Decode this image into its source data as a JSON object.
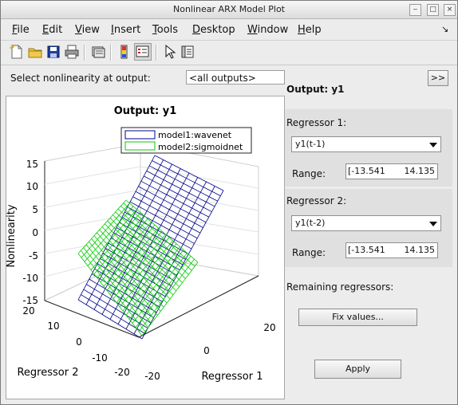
{
  "window": {
    "title": "Nonlinear ARX Model Plot"
  },
  "menu": {
    "items": [
      {
        "label": "File",
        "u": "F"
      },
      {
        "label": "Edit",
        "u": "E"
      },
      {
        "label": "View",
        "u": "V"
      },
      {
        "label": "Insert",
        "u": "I"
      },
      {
        "label": "Tools",
        "u": "T"
      },
      {
        "label": "Desktop",
        "u": "D"
      },
      {
        "label": "Window",
        "u": "W"
      },
      {
        "label": "Help",
        "u": "H"
      }
    ],
    "dock_glyph": "↘"
  },
  "select": {
    "label": "Select nonlinearity at output:",
    "value": "<all outputs>"
  },
  "right": {
    "toggle": ">>",
    "output_title": "Output: y1",
    "reg1": {
      "label": "Regressor 1:",
      "value": "y1(t-1)",
      "range_label": "Range:",
      "range_min": "[-13.541",
      "range_max": "14.135"
    },
    "reg2": {
      "label": "Regressor 2:",
      "value": "y1(t-2)",
      "range_label": "Range:",
      "range_min": "[-13.541",
      "range_max": "14.135"
    },
    "remaining_label": "Remaining regressors:",
    "fix_button": "Fix values...",
    "apply_button": "Apply"
  },
  "plot": {
    "title": "Output: y1",
    "zlabel": "Nonlinearity",
    "xlabel": "Regressor 1",
    "ylabel": "Regressor 2",
    "legend": [
      {
        "label": "model1:wavenet",
        "color": "#00008b"
      },
      {
        "label": "model2:sigmoidnet",
        "color": "#00cc00"
      }
    ],
    "z_ticks": [
      "15",
      "10",
      "5",
      "0",
      "-5",
      "-10",
      "-15"
    ],
    "y_ticks": [
      "20",
      "10",
      "0",
      "-10",
      "-20"
    ],
    "x_ticks": [
      "-20",
      "0",
      "20"
    ]
  }
}
